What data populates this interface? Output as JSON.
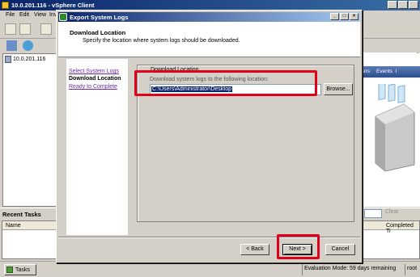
{
  "main_window": {
    "title": "10.0.201.116 - vSphere Client",
    "menu": [
      "File",
      "Edit",
      "View",
      "Inv"
    ],
    "tree_node": "10.0.201.116",
    "tabs_visible": [
      "ers",
      "Events",
      "l"
    ],
    "colors": {
      "titlebar": "#0a246a",
      "tab_bar": "#2b4e8c"
    }
  },
  "recent_tasks": {
    "label": "Recent Tasks",
    "clear_label": "Clear",
    "columns": [
      "Name",
      "Completed Ti"
    ]
  },
  "status_bar": {
    "tasks_button": "Tasks",
    "evaluation": "Evaluation Mode: 59 days remaining",
    "user": "root"
  },
  "dialog": {
    "title": "Export System Logs",
    "header_title": "Download Location",
    "header_subtitle": "Specify the location where system logs should be downloaded.",
    "nav": {
      "select_logs": "Select System Logs",
      "download_location": "Download Location",
      "ready": "Ready to Complete"
    },
    "group_label": "Download Location",
    "group_description": "Download system logs to the following location:",
    "path_value": "C:\\Users\\Administrator\\Desktop",
    "browse_label": "Browse...",
    "buttons": {
      "back": "< Back",
      "next": "Next >",
      "cancel": "Cancel"
    },
    "annotation_color": "#e1001a"
  }
}
